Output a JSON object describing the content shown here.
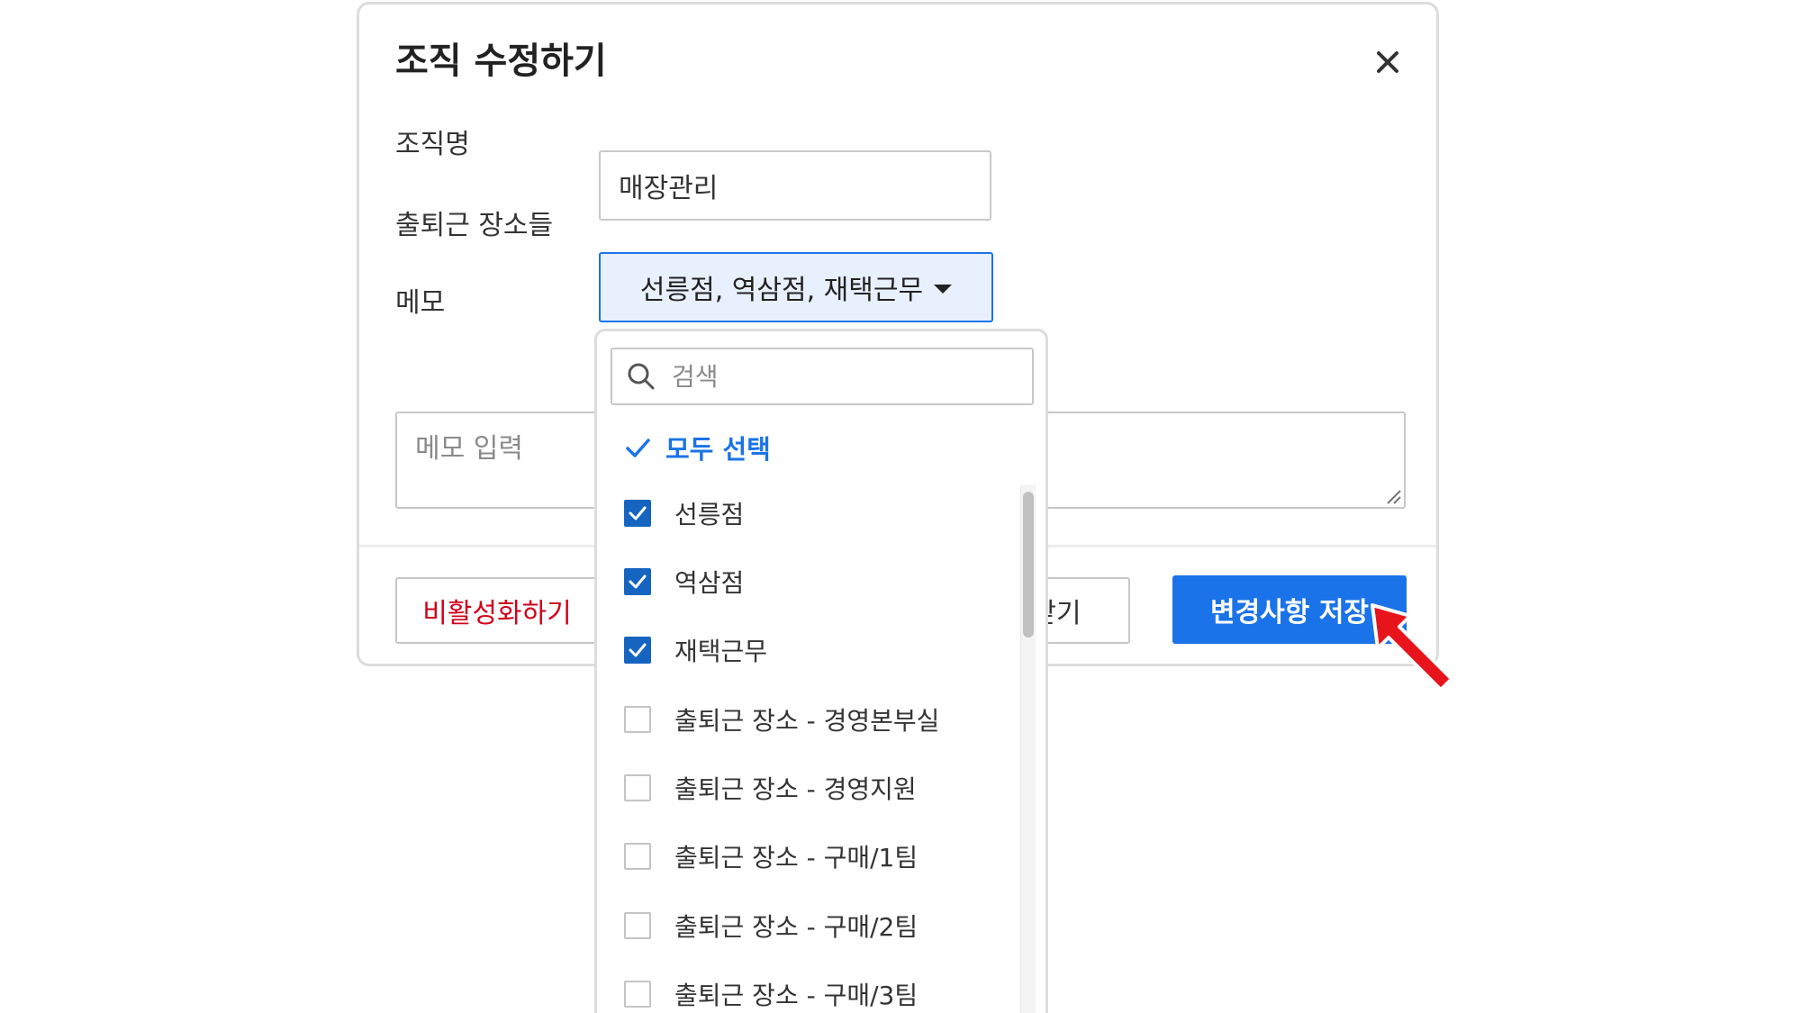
{
  "modal": {
    "title": "조직 수정하기"
  },
  "form": {
    "name_label": "조직명",
    "name_value": "매장관리",
    "places_label": "출퇴근 장소들",
    "places_selected_text": "선릉점, 역삼점, 재택근무",
    "memo_label": "메모",
    "memo_placeholder": "메모 입력"
  },
  "footer": {
    "deactivate_label": "비활성화하기",
    "close_label": "닫기",
    "save_label": "변경사항 저장"
  },
  "dropdown": {
    "search_placeholder": "검색",
    "select_all_label": "모두 선택",
    "options": [
      {
        "label": "선릉점",
        "checked": true
      },
      {
        "label": "역삼점",
        "checked": true
      },
      {
        "label": "재택근무",
        "checked": true
      },
      {
        "label": "출퇴근 장소 - 경영본부실",
        "checked": false
      },
      {
        "label": "출퇴근 장소 - 경영지원",
        "checked": false
      },
      {
        "label": "출퇴근 장소 - 구매/1팀",
        "checked": false
      },
      {
        "label": "출퇴근 장소 - 구매/2팀",
        "checked": false
      },
      {
        "label": "출퇴근 장소 - 구매/3팀",
        "checked": false
      }
    ]
  },
  "colors": {
    "accent": "#1a73e8",
    "checkbox_checked": "#1565c0",
    "danger_text": "#d0021b",
    "pointer_arrow": "#e8141c"
  }
}
